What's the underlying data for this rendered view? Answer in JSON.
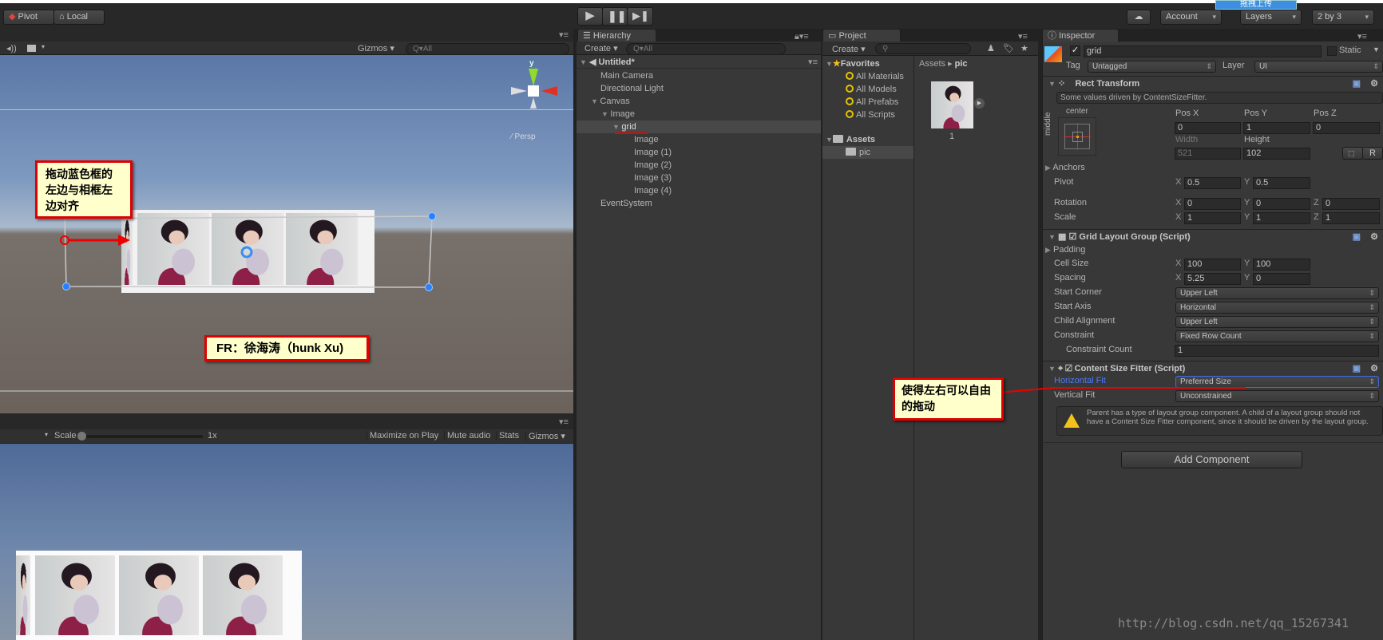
{
  "toolbar": {
    "pivot": "Pivot",
    "local": "Local",
    "account": "Account",
    "layers": "Layers",
    "layout": "2 by 3",
    "upload_banner": "拖拽上传"
  },
  "scene": {
    "gizmos": "Gizmos",
    "search_placeholder": "All",
    "persp": "Persp",
    "axis_y": "y",
    "axis_x": "x"
  },
  "game": {
    "scale_label": "Scale",
    "scale_value": "1x",
    "scale_level": 0,
    "maximize": "Maximize on Play",
    "mute": "Mute audio",
    "stats": "Stats",
    "gizmos": "Gizmos"
  },
  "hierarchy": {
    "tab": "Hierarchy",
    "create": "Create",
    "search_placeholder": "All",
    "scene_name": "Untitled*",
    "items": [
      {
        "label": "Main Camera"
      },
      {
        "label": "Directional Light"
      },
      {
        "label": "Canvas"
      },
      {
        "label": "Image"
      },
      {
        "label": "grid",
        "selected": true
      },
      {
        "label": "Image"
      },
      {
        "label": "Image (1)"
      },
      {
        "label": "Image (2)"
      },
      {
        "label": "Image (3)"
      },
      {
        "label": "Image (4)"
      },
      {
        "label": "EventSystem"
      }
    ]
  },
  "project": {
    "tab": "Project",
    "create": "Create",
    "favorites": "Favorites",
    "favorite_items": [
      "All Materials",
      "All Models",
      "All Prefabs",
      "All Scripts"
    ],
    "assets": "Assets",
    "folders": [
      "pic"
    ],
    "breadcrumb": [
      "Assets",
      "pic"
    ],
    "asset_items": [
      {
        "label": "1"
      }
    ]
  },
  "inspector": {
    "tab": "Inspector",
    "object_name": "grid",
    "active": true,
    "static_label": "Static",
    "tag_label": "Tag",
    "tag_value": "Untagged",
    "layer_label": "Layer",
    "layer_value": "UI",
    "rect_transform": {
      "title": "Rect Transform",
      "info": "Some values driven by ContentSizeFitter.",
      "anchor_h": "center",
      "anchor_v": "middle",
      "pos_x_label": "Pos X",
      "pos_y_label": "Pos Y",
      "pos_z_label": "Pos Z",
      "pos_x": "0",
      "pos_y": "1",
      "pos_z": "0",
      "width_label": "Width",
      "height_label": "Height",
      "width": "521",
      "height": "102",
      "r_button": "R",
      "anchors": "Anchors",
      "pivot": "Pivot",
      "pivot_x": "0.5",
      "pivot_y": "0.5",
      "rotation": "Rotation",
      "rot_x": "0",
      "rot_y": "0",
      "rot_z": "0",
      "scale": "Scale",
      "scale_x": "1",
      "scale_y": "1",
      "scale_z": "1"
    },
    "grid_layout": {
      "title": "Grid Layout Group (Script)",
      "padding": "Padding",
      "cell_size": "Cell Size",
      "cell_x": "100",
      "cell_y": "100",
      "spacing": "Spacing",
      "spacing_x": "5.25",
      "spacing_y": "0",
      "start_corner": "Start Corner",
      "start_corner_value": "Upper Left",
      "start_axis": "Start Axis",
      "start_axis_value": "Horizontal",
      "child_alignment": "Child Alignment",
      "child_alignment_value": "Upper Left",
      "constraint": "Constraint",
      "constraint_value": "Fixed Row Count",
      "constraint_count": "Constraint Count",
      "constraint_count_value": "1"
    },
    "content_size_fitter": {
      "title": "Content Size Fitter (Script)",
      "horizontal_fit": "Horizontal Fit",
      "horizontal_fit_value": "Preferred Size",
      "vertical_fit": "Vertical Fit",
      "vertical_fit_value": "Unconstrained",
      "warning": "Parent has a type of layout group component. A child of a layout group should not have a Content Size Fitter component, since it should be driven by the layout group."
    },
    "add_component": "Add Component"
  },
  "annotations": {
    "drag_note": "拖动蓝色框的左边与相框左边对齐",
    "credit": "FR：徐海涛（hunk Xu)",
    "fit_note": "使得左右可以自由的拖动"
  },
  "watermark": "http://blog.csdn.net/qq_15267341",
  "colors": {
    "annotation_border": "#e00000",
    "annotation_bg": "#ffffcc",
    "highlight_label": "#4a7cff",
    "selection_handle": "#2a7fff"
  }
}
